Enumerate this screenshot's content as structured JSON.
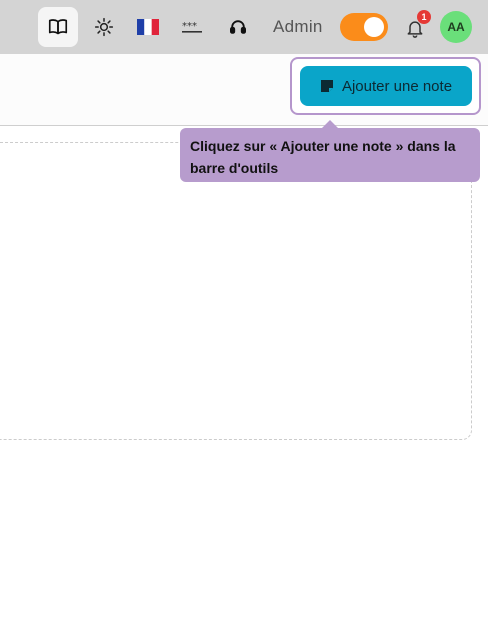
{
  "header": {
    "icons": [
      "book-open-icon",
      "sun-icon",
      "flag-fr-icon",
      "password-icon",
      "support-icon"
    ],
    "admin_label": "Admin",
    "admin_toggle_on": true,
    "notification_count": "1",
    "avatar_initials": "AA"
  },
  "toolbar": {
    "add_note_label": "Ajouter une note"
  },
  "tooltip": {
    "text": "Cliquez sur « Ajouter une note » dans la barre d'outils"
  },
  "colors": {
    "accent": "#0aa5c9",
    "toggle": "#fb8c1a",
    "tooltip": "#b79ccd",
    "avatar": "#6adf7a",
    "badge": "#e53935"
  }
}
